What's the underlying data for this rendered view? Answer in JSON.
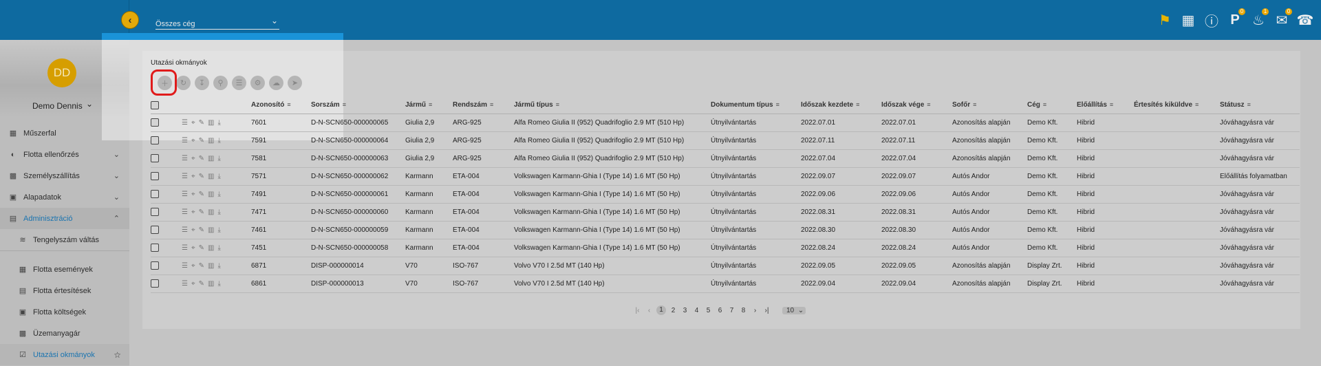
{
  "header": {
    "back_icon": "chevron-left-icon",
    "company_select": "Összes cég",
    "icons": [
      {
        "name": "tag-icon",
        "badge": ""
      },
      {
        "name": "dashboard-icon",
        "badge": ""
      },
      {
        "name": "help-icon",
        "badge": ""
      },
      {
        "name": "parking-icon",
        "badge": "0"
      },
      {
        "name": "bell-icon",
        "badge": "1"
      },
      {
        "name": "chat-icon",
        "badge": "0"
      },
      {
        "name": "headset-icon",
        "badge": ""
      }
    ]
  },
  "sidebar": {
    "avatar_initials": "DD",
    "user_name": "Demo Dennis",
    "items": [
      {
        "label": "Műszerfal"
      },
      {
        "label": "Flotta ellenőrzés"
      },
      {
        "label": "Személyszállítás"
      },
      {
        "label": "Alapadatok"
      },
      {
        "label": "Adminisztráció"
      },
      {
        "label": "Tengelyszám váltás"
      },
      {
        "label": "Flotta események"
      },
      {
        "label": "Flotta értesítések"
      },
      {
        "label": "Flotta költségek"
      },
      {
        "label": "Üzemanyagár"
      },
      {
        "label": "Utazási okmányok"
      }
    ]
  },
  "main": {
    "title": "Utazási okmányok",
    "columns": [
      "Azonosító",
      "Sorszám",
      "Jármű",
      "Rendszám",
      "Jármű típus",
      "Dokumentum típus",
      "Időszak kezdete",
      "Időszak vége",
      "Sofőr",
      "Cég",
      "Előállítás",
      "Értesítés kiküldve",
      "Státusz"
    ],
    "rows": [
      [
        "7601",
        "D-N-SCN650-000000065",
        "Giulia 2,9",
        "ARG-925",
        "Alfa Romeo Giulia II (952) Quadrifoglio 2.9 MT (510 Hp)",
        "Útnyilvántartás",
        "2022.07.01",
        "2022.07.01",
        "Azonosítás alapján",
        "Demo Kft.",
        "Hibrid",
        "",
        "Jóváhagyásra vár"
      ],
      [
        "7591",
        "D-N-SCN650-000000064",
        "Giulia 2,9",
        "ARG-925",
        "Alfa Romeo Giulia II (952) Quadrifoglio 2.9 MT (510 Hp)",
        "Útnyilvántartás",
        "2022.07.11",
        "2022.07.11",
        "Azonosítás alapján",
        "Demo Kft.",
        "Hibrid",
        "",
        "Jóváhagyásra vár"
      ],
      [
        "7581",
        "D-N-SCN650-000000063",
        "Giulia 2,9",
        "ARG-925",
        "Alfa Romeo Giulia II (952) Quadrifoglio 2.9 MT (510 Hp)",
        "Útnyilvántartás",
        "2022.07.04",
        "2022.07.04",
        "Azonosítás alapján",
        "Demo Kft.",
        "Hibrid",
        "",
        "Jóváhagyásra vár"
      ],
      [
        "7571",
        "D-N-SCN650-000000062",
        "Karmann",
        "ETA-004",
        "Volkswagen Karmann-Ghia I (Type 14) 1.6 MT (50 Hp)",
        "Útnyilvántartás",
        "2022.09.07",
        "2022.09.07",
        "Autós Andor",
        "Demo Kft.",
        "Hibrid",
        "",
        "Előállítás folyamatban"
      ],
      [
        "7491",
        "D-N-SCN650-000000061",
        "Karmann",
        "ETA-004",
        "Volkswagen Karmann-Ghia I (Type 14) 1.6 MT (50 Hp)",
        "Útnyilvántartás",
        "2022.09.06",
        "2022.09.06",
        "Autós Andor",
        "Demo Kft.",
        "Hibrid",
        "",
        "Jóváhagyásra vár"
      ],
      [
        "7471",
        "D-N-SCN650-000000060",
        "Karmann",
        "ETA-004",
        "Volkswagen Karmann-Ghia I (Type 14) 1.6 MT (50 Hp)",
        "Útnyilvántartás",
        "2022.08.31",
        "2022.08.31",
        "Autós Andor",
        "Demo Kft.",
        "Hibrid",
        "",
        "Jóváhagyásra vár"
      ],
      [
        "7461",
        "D-N-SCN650-000000059",
        "Karmann",
        "ETA-004",
        "Volkswagen Karmann-Ghia I (Type 14) 1.6 MT (50 Hp)",
        "Útnyilvántartás",
        "2022.08.30",
        "2022.08.30",
        "Autós Andor",
        "Demo Kft.",
        "Hibrid",
        "",
        "Jóváhagyásra vár"
      ],
      [
        "7451",
        "D-N-SCN650-000000058",
        "Karmann",
        "ETA-004",
        "Volkswagen Karmann-Ghia I (Type 14) 1.6 MT (50 Hp)",
        "Útnyilvántartás",
        "2022.08.24",
        "2022.08.24",
        "Autós Andor",
        "Demo Kft.",
        "Hibrid",
        "",
        "Jóváhagyásra vár"
      ],
      [
        "6871",
        "DISP-000000014",
        "V70",
        "ISO-767",
        "Volvo V70 I 2.5d MT (140 Hp)",
        "Útnyilvántartás",
        "2022.09.05",
        "2022.09.05",
        "Azonosítás alapján",
        "Display Zrt.",
        "Hibrid",
        "",
        "Jóváhagyásra vár"
      ],
      [
        "6861",
        "DISP-000000013",
        "V70",
        "ISO-767",
        "Volvo V70 I 2.5d MT (140 Hp)",
        "Útnyilvántartás",
        "2022.09.04",
        "2022.09.04",
        "Azonosítás alapján",
        "Display Zrt.",
        "Hibrid",
        "",
        "Jóváhagyásra vár"
      ]
    ]
  },
  "pagination": {
    "pages": [
      "1",
      "2",
      "3",
      "4",
      "5",
      "6",
      "7",
      "8"
    ],
    "current": "1",
    "page_size": "10"
  },
  "colors": {
    "header_bg": "#0e6aa0",
    "accent_yellow": "#e3a90a",
    "highlight_red": "#e01b1b",
    "active_link": "#1a74b0"
  }
}
